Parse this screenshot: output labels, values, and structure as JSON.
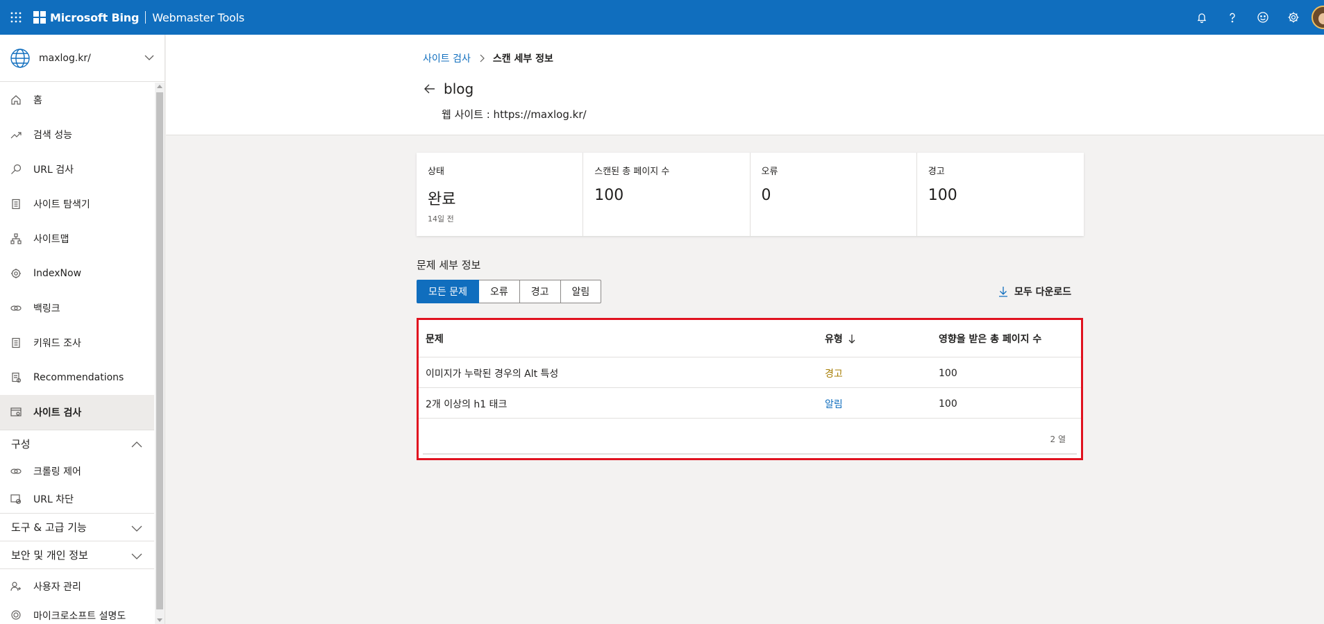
{
  "topbar": {
    "brand": "Microsoft Bing",
    "product": "Webmaster Tools",
    "accent_color": "#106ebe",
    "icons": [
      "waffle-icon",
      "bell-icon",
      "help-icon",
      "smiley-icon",
      "gear-icon",
      "avatar"
    ]
  },
  "sidebar": {
    "site": "maxlog.kr/",
    "items": [
      {
        "label": "홈",
        "icon": "home-icon"
      },
      {
        "label": "검색 성능",
        "icon": "trend-icon"
      },
      {
        "label": "URL 검사",
        "icon": "search-icon"
      },
      {
        "label": "사이트 탐색기",
        "icon": "document-icon"
      },
      {
        "label": "사이트맵",
        "icon": "sitemap-icon"
      },
      {
        "label": "IndexNow",
        "icon": "gear-icon"
      },
      {
        "label": "백링크",
        "icon": "link-icon"
      },
      {
        "label": "키워드 조사",
        "icon": "document-icon"
      },
      {
        "label": "Recommendations",
        "icon": "recommendations-icon"
      },
      {
        "label": "사이트 검사",
        "icon": "site-scan-icon",
        "active": true
      }
    ],
    "group_config": "구성",
    "config_items": [
      {
        "label": "크롤링 제어",
        "icon": "link-icon"
      },
      {
        "label": "URL 차단",
        "icon": "block-icon"
      }
    ],
    "group_tools": "도구 & 고급 기능",
    "group_security": "보안 및 개인 정보",
    "user_mgmt": "사용자 관리",
    "survey": "마이크로소프트 설명도"
  },
  "header": {
    "breadcrumb_parent": "사이트 검사",
    "breadcrumb_current": "스캔 세부 정보",
    "title": "blog",
    "website": "웹 사이트 : https://maxlog.kr/"
  },
  "cards": [
    {
      "label": "상태",
      "value": "완료",
      "sub": "14일 전"
    },
    {
      "label": "스캔된 총 페이지 수",
      "value": "100"
    },
    {
      "label": "오류",
      "value": "0"
    },
    {
      "label": "경고",
      "value": "100"
    }
  ],
  "issues": {
    "title": "문제 세부 정보",
    "filters": [
      "모든 문제",
      "오류",
      "경고",
      "알림"
    ],
    "download": "모두 다운로드",
    "columns": [
      "문제",
      "유형",
      "영향을 받은 총 페이지 수"
    ],
    "rows": [
      {
        "issue": "이미지가 누락된 경우의 Alt 특성",
        "type": "경고",
        "pages": "100"
      },
      {
        "issue": "2개 이상의 h1 태크",
        "type": "알림",
        "pages": "100"
      }
    ],
    "row_count": "2 열",
    "highlight_color": "#e0121f"
  }
}
